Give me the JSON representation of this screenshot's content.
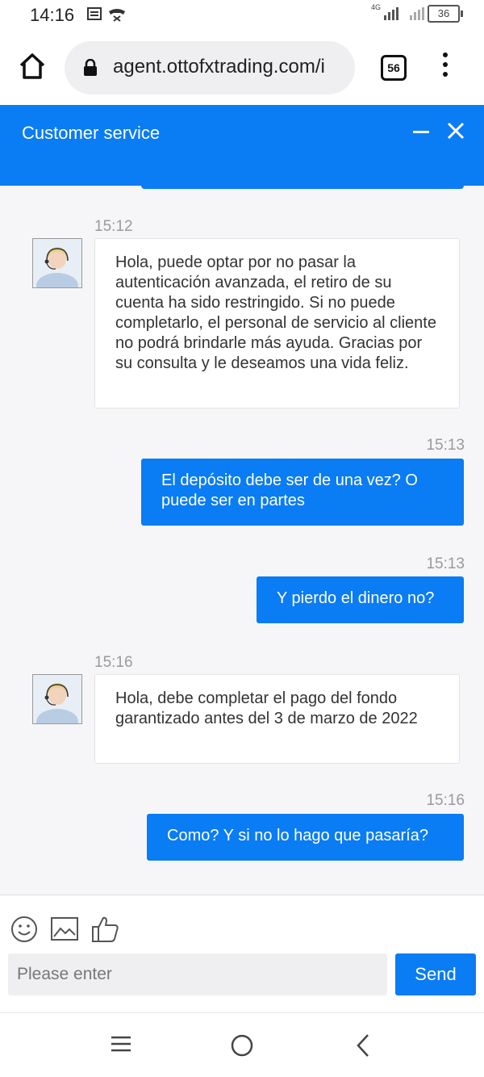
{
  "status_bar": {
    "time": "14:16",
    "network": "4G",
    "battery": "36"
  },
  "browser": {
    "url": "agent.ottofxtrading.com/i",
    "tab_count": "56"
  },
  "chat_header": {
    "title": "Customer service"
  },
  "messages": [
    {
      "direction": "in",
      "time": "15:12",
      "text": "Hola, puede optar por no pasar la autenticación avanzada, el retiro de su cuenta ha sido restringido. Si no puede completarlo, el personal de servicio al cliente no podrá brindarle más ayuda. Gracias por su consulta y le deseamos una vida feliz."
    },
    {
      "direction": "out",
      "time": "15:13",
      "text": "El depósito debe ser de una vez? O puede ser en partes"
    },
    {
      "direction": "out",
      "time": "15:13",
      "text": "Y pierdo el dinero no?"
    },
    {
      "direction": "in",
      "time": "15:16",
      "text": "Hola, debe completar el pago del fondo garantizado antes del 3 de marzo de 2022"
    },
    {
      "direction": "out",
      "time": "15:16",
      "text": "Como? Y si no lo hago que pasaría?"
    }
  ],
  "composer": {
    "placeholder": "Please enter",
    "send_label": "Send"
  },
  "colors": {
    "accent": "#0a7cf4"
  }
}
